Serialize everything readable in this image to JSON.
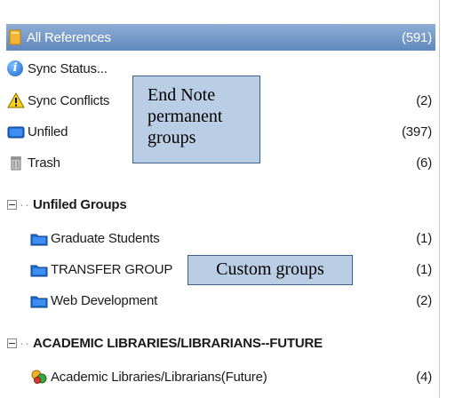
{
  "library": {
    "all_references": {
      "label": "All References",
      "count": "(591)"
    },
    "sync_status": {
      "label": "Sync Status..."
    },
    "sync_conflicts": {
      "label": "Sync Conflicts",
      "count": "(2)"
    },
    "unfiled": {
      "label": "Unfiled",
      "count": "(397)"
    },
    "trash": {
      "label": "Trash",
      "count": "(6)"
    }
  },
  "groups": [
    {
      "header": "Unfiled Groups",
      "items": [
        {
          "label": "Graduate Students",
          "count": "(1)",
          "icon": "folder-icon"
        },
        {
          "label": "TRANSFER GROUP",
          "count": "(1)",
          "icon": "folder-icon"
        },
        {
          "label": "Web Development",
          "count": "(2)",
          "icon": "folder-icon"
        }
      ]
    },
    {
      "header": "ACADEMIC LIBRARIES/LIBRARIANS--FUTURE",
      "items": [
        {
          "label": "Academic Libraries/Librarians(Future)",
          "count": "(4)",
          "icon": "smart-group-icon"
        }
      ]
    }
  ],
  "callouts": {
    "permanent": [
      "End Note",
      "permanent",
      "groups"
    ],
    "custom": "Custom groups"
  },
  "colors": {
    "selection": "#6f96c8",
    "callout_fill": "#b9cde4",
    "callout_border": "#3c5f8c"
  }
}
